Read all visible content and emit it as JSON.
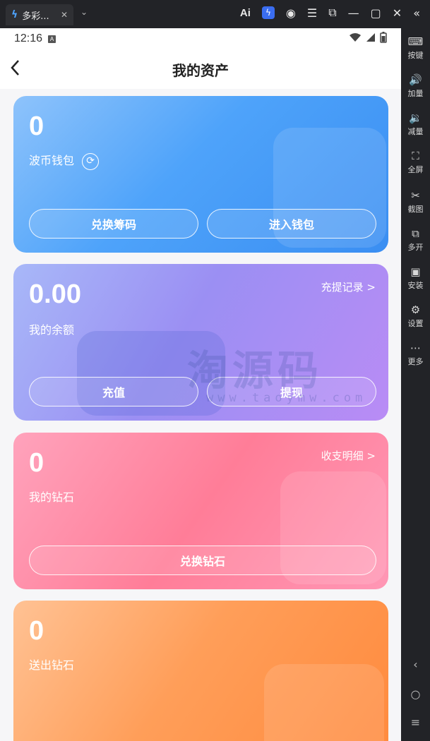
{
  "window": {
    "tab_title": "多彩...",
    "tab_close": "✕",
    "dropdown": "⌄",
    "ai_label": "Ai"
  },
  "status_bar": {
    "time": "12:16",
    "notif_icon": "A"
  },
  "nav": {
    "back": "‹",
    "title": "我的资产"
  },
  "cards": {
    "wallet": {
      "amount": "0",
      "label": "波币钱包",
      "refresh_icon": "⟳",
      "btn_left": "兑换筹码",
      "btn_right": "进入钱包"
    },
    "balance": {
      "amount": "0.00",
      "label": "我的余额",
      "link": "充提记录 >",
      "btn_left": "充值",
      "btn_right": "提现"
    },
    "diamond": {
      "amount": "0",
      "label": "我的钻石",
      "link": "收支明细 >",
      "btn": "兑换钻石"
    },
    "sent": {
      "amount": "0",
      "label": "送出钻石"
    }
  },
  "watermark": {
    "text": "淘源码",
    "url": "www.taoymw.com"
  },
  "sidebar": {
    "items": [
      {
        "icon": "⌨",
        "label": "按键"
      },
      {
        "icon": "🔊",
        "label": "加量"
      },
      {
        "icon": "🔉",
        "label": "减量"
      },
      {
        "icon": "⛶",
        "label": "全屏"
      },
      {
        "icon": "✂",
        "label": "截图"
      },
      {
        "icon": "⧉",
        "label": "多开"
      },
      {
        "icon": "▣",
        "label": "安装"
      },
      {
        "icon": "⚙",
        "label": "设置"
      },
      {
        "icon": "⋯",
        "label": "更多"
      }
    ],
    "nav": {
      "back": "‹",
      "home": "○",
      "menu": "≡"
    }
  }
}
